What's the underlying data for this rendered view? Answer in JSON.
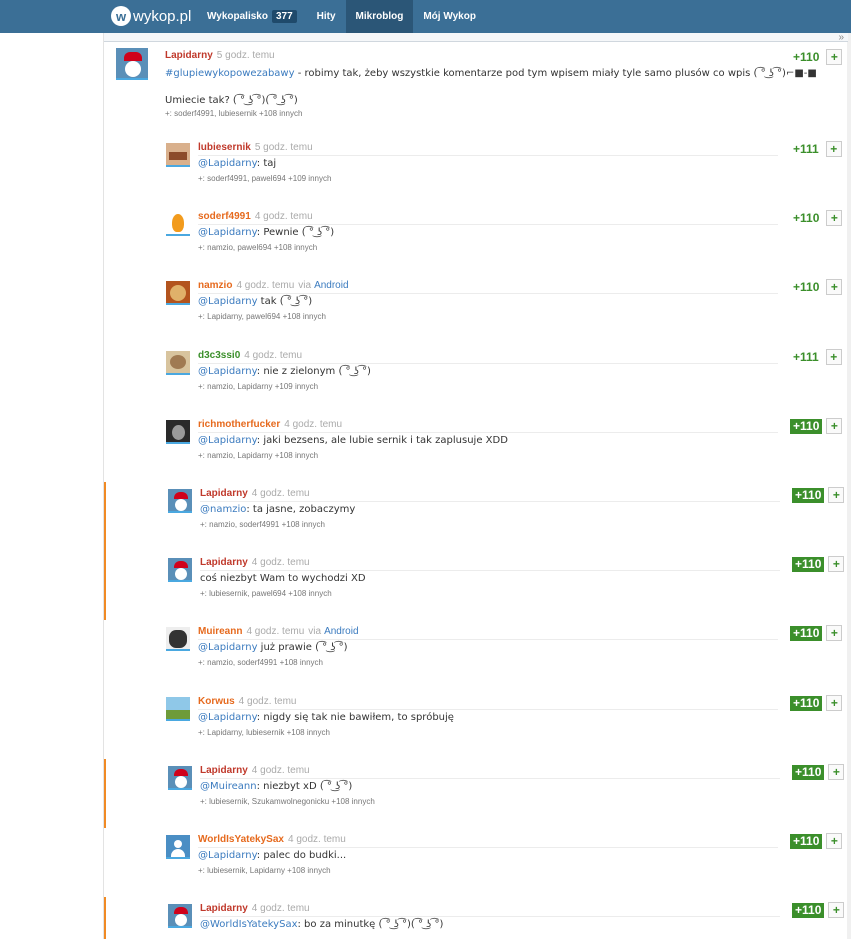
{
  "header": {
    "logo_mark": "w",
    "logo_text": "wykop.pl",
    "nav": [
      {
        "label": "Wykopalisko",
        "badge": "377"
      },
      {
        "label": "Hity"
      },
      {
        "label": "Mikroblog",
        "active": true
      },
      {
        "label": "Mój Wykop"
      }
    ]
  },
  "collapse_icon": "»",
  "main_entry": {
    "author": "Lapidarny",
    "time": "5 godz. temu",
    "score": "+110",
    "plus": "+",
    "tag": "#glupiewykopowezabawy",
    "text": " - robimy tak, żeby wszystkie komentarze pod tym wpisem miały tyle samo plusów co wpis ( ͡° ͜ʖ ͡°)⌐■-■",
    "line2": "Umiecie tak? ( ͡° ͜ʖ ͡°)( ͡° ͜ʖ ͡°)",
    "voters": "+: soderf4991, lubiesernik +108 innych"
  },
  "comments": [
    {
      "author": "lubiesernik",
      "time": "5 godz. temu",
      "score": "+111",
      "mention": "@Lapidarny",
      "text": ": taj",
      "voters": "+: soderf4991, pawel694 +109 innych"
    },
    {
      "author": "soderf4991",
      "time": "4 godz. temu",
      "score": "+110",
      "mention": "@Lapidarny",
      "text": ": Pewnie ( ͡° ͜ʖ ͡°)",
      "voters": "+: namzio, pawel694 +108 innych"
    },
    {
      "author": "namzio",
      "time": "4 godz. temu",
      "via": "via",
      "via_app": "Android",
      "score": "+110",
      "mention": "@Lapidarny",
      "text": " tak ( ͡° ͜ʖ ͡°)",
      "voters": "+: Lapidarny, pawel694 +108 innych"
    },
    {
      "author": "d3c3ssi0",
      "time": "4 godz. temu",
      "score": "+111",
      "mention": "@Lapidarny",
      "text": ": nie z zielonym ( ͡° ͜ʖ ͡°)",
      "voters": "+: namzio, Lapidarny +109 innych"
    },
    {
      "author": "richmotherfucker",
      "time": "4 godz. temu",
      "score": "+110",
      "mention": "@Lapidarny",
      "text": ": jaki bezsens, ale lubie sernik i tak zaplusuje XDD",
      "voters": "+: namzio, Lapidarny +108 innych"
    },
    {
      "author": "Lapidarny",
      "time": "4 godz. temu",
      "score": "+110",
      "mention": "@namzio",
      "text": ": ta jasne, zobaczymy",
      "voters": "+: namzio, soderf4991 +108 innych"
    },
    {
      "author": "Lapidarny",
      "time": "4 godz. temu",
      "score": "+110",
      "mention": "",
      "text": "coś niezbyt Wam to wychodzi XD",
      "voters": "+: lubiesernik, pawel694 +108 innych"
    },
    {
      "author": "Muireann",
      "time": "4 godz. temu",
      "via": "via",
      "via_app": "Android",
      "score": "+110",
      "mention": "@Lapidarny",
      "text": " już prawie ( ͡° ͜ʖ ͡°)",
      "voters": "+: namzio, soderf4991 +108 innych"
    },
    {
      "author": "Korwus",
      "time": "4 godz. temu",
      "score": "+110",
      "mention": "@Lapidarny",
      "text": ": nigdy się tak nie bawiłem, to spróbuję",
      "voters": "+: Lapidarny, lubiesernik +108 innych"
    },
    {
      "author": "Lapidarny",
      "time": "4 godz. temu",
      "score": "+110",
      "mention": "@Muireann",
      "text": ": niezbyt xD ( ͡° ͜ʖ ͡°)",
      "voters": "+: lubiesernik, Szukamwolnegonicku +108 innych"
    },
    {
      "author": "WorldIsYatekySax",
      "time": "4 godz. temu",
      "score": "+110",
      "mention": "@Lapidarny",
      "text": ": palec do budki...",
      "voters": "+: lubiesernik, Lapidarny +108 innych"
    },
    {
      "author": "Lapidarny",
      "time": "4 godz. temu",
      "score": "+110",
      "mention": "@WorldIsYatekySax",
      "text": ": bo za minutkę ( ͡° ͜ʖ ͡°)( ͡° ͜ʖ ͡°)",
      "voters": ""
    }
  ],
  "plus": "+"
}
